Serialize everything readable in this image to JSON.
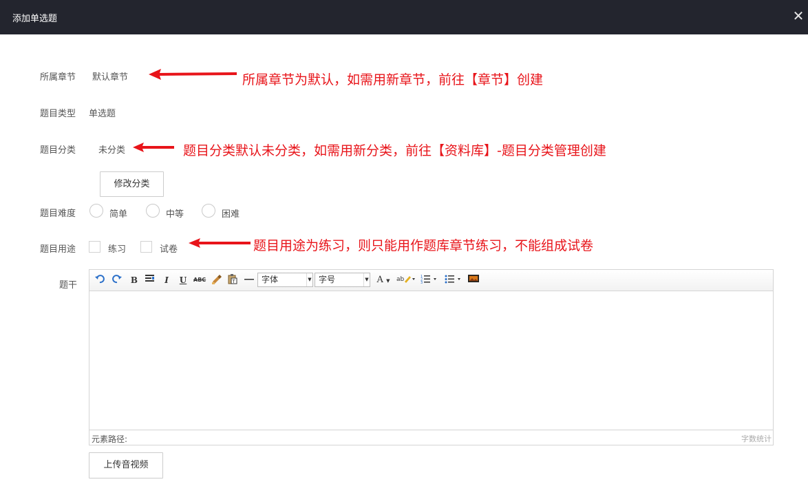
{
  "dialog": {
    "title": "添加单选题",
    "close_symbol": "✕"
  },
  "form": {
    "chapter": {
      "label": "所属章节",
      "value": "默认章节"
    },
    "type": {
      "label": "题目类型",
      "value": "单选题"
    },
    "category": {
      "label": "题目分类",
      "value": "未分类",
      "modify_button": "修改分类"
    },
    "difficulty": {
      "label": "题目难度",
      "options": [
        "简单",
        "中等",
        "困难"
      ]
    },
    "usage": {
      "label": "题目用途",
      "options": [
        "练习",
        "试卷"
      ]
    },
    "stem": {
      "label": "题干"
    },
    "upload_button": "上传音视频"
  },
  "editor": {
    "toolbar": {
      "font_select": "字体",
      "size_select": "字号",
      "icons": [
        "undo-icon",
        "redo-icon",
        "bold-icon",
        "align-icon",
        "italic-icon",
        "underline-icon",
        "strikethrough-icon",
        "format-painter-icon",
        "paste-text-icon",
        "horizontal-rule-icon",
        "font-color-icon",
        "highlight-icon",
        "ordered-list-icon",
        "unordered-list-icon",
        "image-icon"
      ]
    },
    "status_path": "元素路径:",
    "word_count": "字数统计"
  },
  "annotations": {
    "chapter_note": "所属章节为默认，如需用新章节，前往【章节】创建",
    "category_note": "题目分类默认未分类，如需用新分类，前往【资料库】-题目分类管理创建",
    "usage_note": "题目用途为练习，则只能用作题库章节练习，不能组成试卷",
    "color": "#e8141a"
  }
}
